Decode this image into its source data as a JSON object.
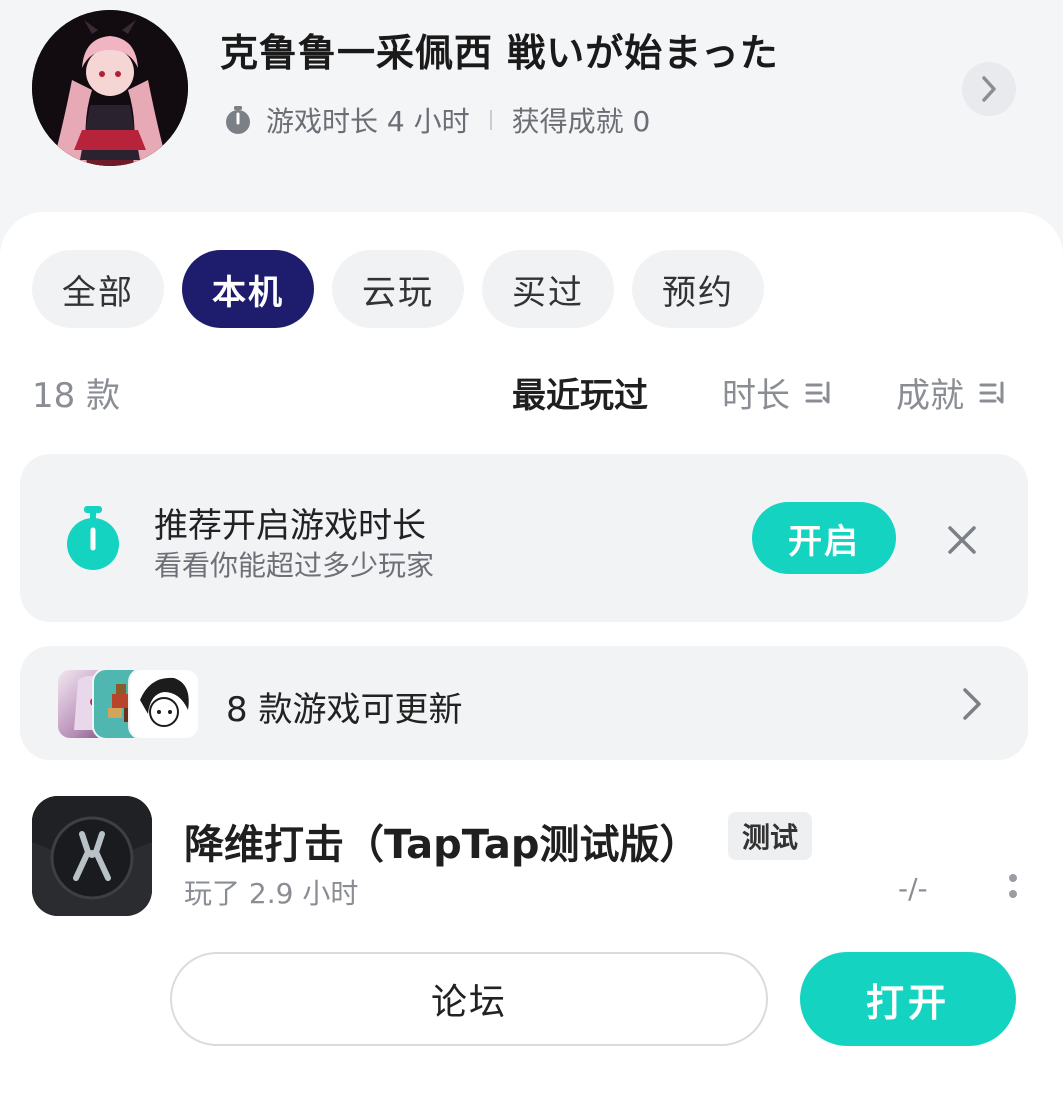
{
  "profile": {
    "username": "克鲁鲁一采佩西 戦いが始まった",
    "stat_icon": "stopwatch-icon",
    "playtime_label": "游戏时长 4 小时",
    "achievement_label": "获得成就 0",
    "arrow_icon": "chevron-right-icon"
  },
  "tabs": [
    {
      "label": "全部",
      "active": false
    },
    {
      "label": "本机",
      "active": true
    },
    {
      "label": "云玩",
      "active": false
    },
    {
      "label": "买过",
      "active": false
    },
    {
      "label": "预约",
      "active": false
    }
  ],
  "list_header": {
    "count": "18 款",
    "sort_recent": "最近玩过",
    "sort_duration": "时长",
    "sort_achievement": "成就",
    "sort_icon": "sort-descending-icon"
  },
  "playtime_banner": {
    "title": "推荐开启游戏时长",
    "subtitle": "看看你能超过多少玩家",
    "button_label": "开启",
    "icon": "stopwatch-icon",
    "close_icon": "close-icon"
  },
  "update_banner": {
    "text": "8 款游戏可更新",
    "arrow_icon": "chevron-right-icon"
  },
  "game": {
    "title": "降维打击（TapTap测试版）",
    "badge": "测试",
    "playtime": "玩了 2.9 小时",
    "achievements": "-/-",
    "icon": "pliers-icon",
    "more_icon": "more-vertical-icon"
  },
  "actions": {
    "forum_label": "论坛",
    "open_label": "打开"
  },
  "colors": {
    "accent_teal": "#14d3c1",
    "active_tab": "#1d1c6d",
    "background": "#f4f5f7"
  }
}
